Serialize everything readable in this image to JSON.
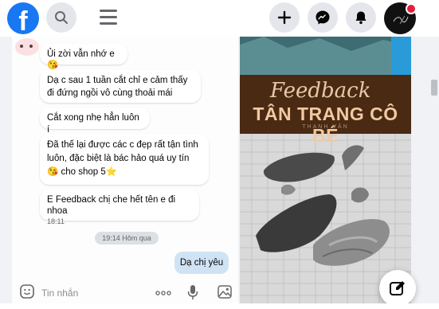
{
  "topbar": {
    "logo_letter": "f"
  },
  "chat": {
    "messages": [
      {
        "text": "Ủi zời vẫn nhớ e😘"
      },
      {
        "text": "Dạ c sau 1 tuần cắt chỉ e cảm thấy đi đứng ngồi vô cùng thoải mái"
      },
      {
        "text": "Cắt xong nhẹ hẳn luôn í"
      },
      {
        "text": "Đã thế lại được các c đẹp rất tận tình luôn, đặc biệt là bác hảo quá uy tín 😘 cho shop 5⭐"
      },
      {
        "text": "E Feedback chị che hết tên e đi nhoa",
        "time": "18:11"
      }
    ],
    "time_separator": "19:14 Hôm qua",
    "outgoing": "Dạ chị yêu",
    "composer_placeholder": "Tin nhắn"
  },
  "photo": {
    "script_title": "Feedback",
    "main_title": "TÂN TRANG CÔ BÉ",
    "watermark": "THANH VÂN"
  },
  "colors": {
    "brand": "#1877f2",
    "banner_bg": "#4a2a12",
    "banner_text": "#f0c9a3",
    "outgoing_bubble": "#cfe3f5"
  }
}
